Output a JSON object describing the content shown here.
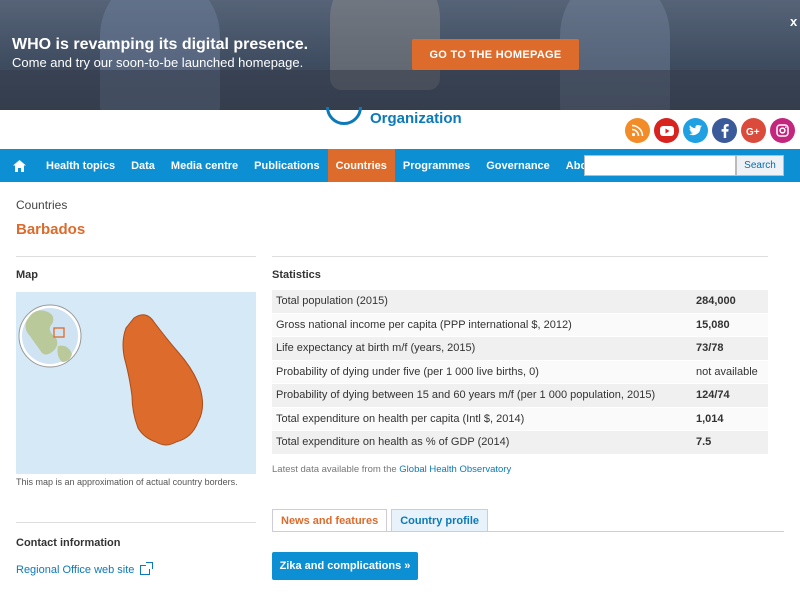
{
  "banner": {
    "title": "WHO is revamping its digital presence.",
    "subtitle": "Come and try our soon-to-be launched homepage.",
    "button": "GO TO THE HOMEPAGE",
    "close": "x"
  },
  "logo": {
    "text": "Organization"
  },
  "social": [
    "rss-icon",
    "youtube-icon",
    "twitter-icon",
    "facebook-icon",
    "googleplus-icon",
    "instagram-icon"
  ],
  "nav": {
    "items": [
      "Health topics",
      "Data",
      "Media centre",
      "Publications",
      "Countries",
      "Programmes",
      "Governance",
      "About WHO"
    ],
    "active": "Countries",
    "search_placeholder": "",
    "search_button": "Search"
  },
  "breadcrumb": "Countries",
  "country": "Barbados",
  "map": {
    "title": "Map",
    "caption": "This map is an approximation of actual country borders."
  },
  "statistics": {
    "title": "Statistics",
    "rows": [
      {
        "label": "Total population (2015)",
        "value": "284,000"
      },
      {
        "label": "Gross national income per capita (PPP international $, 2012)",
        "value": "15,080"
      },
      {
        "label": "Life expectancy at birth m/f (years, 2015)",
        "value": "73/78"
      },
      {
        "label": "Probability of dying under five (per 1 000 live births, 0)",
        "value": "not available"
      },
      {
        "label": "Probability of dying between 15 and 60 years m/f (per 1 000 population, 2015)",
        "value": "124/74"
      },
      {
        "label": "Total expenditure on health per capita (Intl $, 2014)",
        "value": "1,014"
      },
      {
        "label": "Total expenditure on health as % of GDP (2014)",
        "value": "7.5"
      }
    ],
    "note_prefix": "Latest data available from the ",
    "note_link": "Global Health Observatory"
  },
  "tabs": [
    "News and features",
    "Country profile"
  ],
  "zika_button": "Zika and complications »",
  "contact": {
    "title": "Contact information",
    "regional_link": "Regional Office web site"
  },
  "colors": {
    "accent": "#dc6b2c",
    "nav": "#0d8fd3",
    "link": "#0c79b9"
  }
}
